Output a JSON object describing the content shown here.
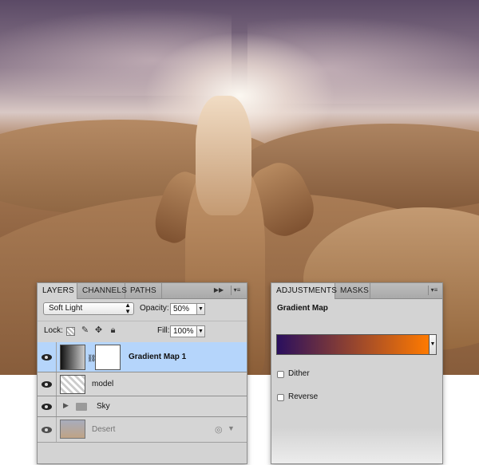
{
  "layers_panel": {
    "tabs": [
      "LAYERS",
      "CHANNELS",
      "PATHS"
    ],
    "active_tab": "LAYERS",
    "blend_mode": "Soft Light",
    "opacity_label": "Opacity:",
    "opacity_value": "50%",
    "lock_label": "Lock:",
    "fill_label": "Fill:",
    "fill_value": "100%",
    "lock_icons": [
      "lock-transparency-icon",
      "lock-pixels-icon",
      "lock-position-icon",
      "lock-all-icon"
    ],
    "layers": [
      {
        "name": "Gradient Map 1",
        "type": "adjustment",
        "visible": true,
        "selected": true
      },
      {
        "name": "model",
        "type": "smart-object",
        "visible": true,
        "selected": false
      },
      {
        "name": "Sky",
        "type": "group",
        "visible": true,
        "selected": false
      },
      {
        "name": "Desert",
        "type": "smart-object",
        "visible": true,
        "selected": false
      }
    ]
  },
  "adjustments_panel": {
    "tabs": [
      "ADJUSTMENTS",
      "MASKS"
    ],
    "active_tab": "ADJUSTMENTS",
    "title": "Gradient Map",
    "gradient_colors": [
      "#2a0f5e",
      "#ff7a00"
    ],
    "dither_label": "Dither",
    "dither_checked": false,
    "reverse_label": "Reverse",
    "reverse_checked": false
  },
  "colors": {
    "panel_bg": "#d3d3d3",
    "selected_row": "#b5d5fb"
  }
}
